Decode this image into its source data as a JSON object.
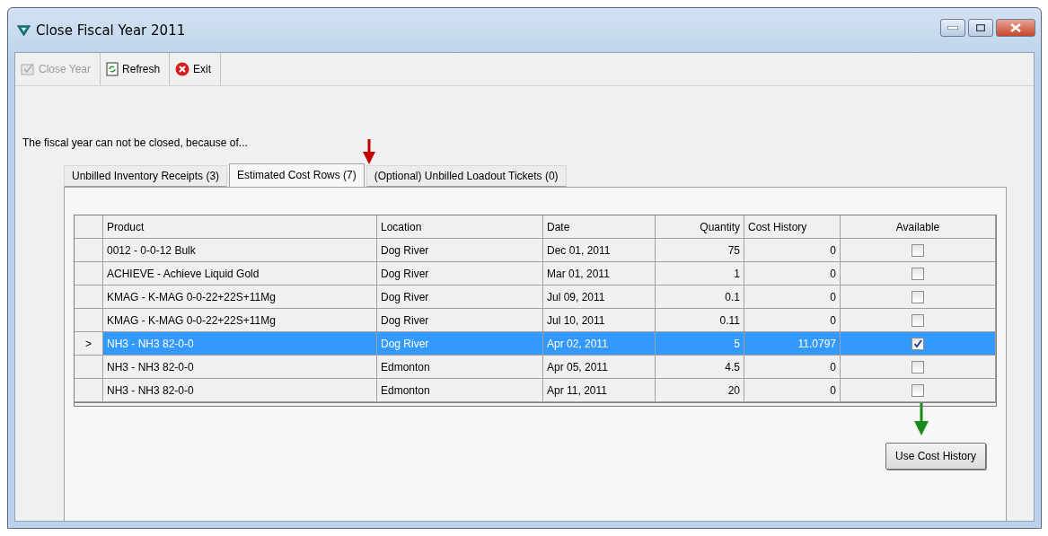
{
  "window": {
    "title": "Close Fiscal Year 2011"
  },
  "toolbar": [
    {
      "label": "Close Year",
      "kind": "close",
      "disabled": true
    },
    {
      "label": "Refresh",
      "kind": "refresh",
      "disabled": false
    },
    {
      "label": "Exit",
      "kind": "exit",
      "disabled": false
    }
  ],
  "message": "The fiscal year can not be closed, because of...",
  "tabs": [
    {
      "label": "Unbilled Inventory Receipts (3)",
      "selected": false
    },
    {
      "label": "Estimated Cost Rows (7)",
      "selected": true
    },
    {
      "label": "(Optional) Unbilled Loadout Tickets (0)",
      "selected": false
    }
  ],
  "table": {
    "columns": [
      "Product",
      "Location",
      "Date",
      "Quantity",
      "Cost History",
      "Available"
    ],
    "rows": [
      {
        "product": "0012 - 0-0-12 Bulk",
        "location": "Dog River",
        "date": "Dec 01, 2011",
        "quantity": "75",
        "cost_history": "0",
        "available": false,
        "selected": false
      },
      {
        "product": "ACHIEVE - Achieve Liquid Gold",
        "location": "Dog River",
        "date": "Mar 01, 2011",
        "quantity": "1",
        "cost_history": "0",
        "available": false,
        "selected": false
      },
      {
        "product": "KMAG - K-MAG 0-0-22+22S+11Mg",
        "location": "Dog River",
        "date": "Jul 09, 2011",
        "quantity": "0.1",
        "cost_history": "0",
        "available": false,
        "selected": false
      },
      {
        "product": "KMAG - K-MAG 0-0-22+22S+11Mg",
        "location": "Dog River",
        "date": "Jul 10, 2011",
        "quantity": "0.11",
        "cost_history": "0",
        "available": false,
        "selected": false
      },
      {
        "product": "NH3 - NH3 82-0-0",
        "location": "Dog River",
        "date": "Apr 02, 2011",
        "quantity": "5",
        "cost_history": "11.0797",
        "available": true,
        "selected": true,
        "marker": ">"
      },
      {
        "product": "NH3 - NH3 82-0-0",
        "location": "Edmonton",
        "date": "Apr 05, 2011",
        "quantity": "4.5",
        "cost_history": "0",
        "available": false,
        "selected": false
      },
      {
        "product": "NH3 - NH3 82-0-0",
        "location": "Edmonton",
        "date": "Apr 11, 2011",
        "quantity": "20",
        "cost_history": "0",
        "available": false,
        "selected": false
      }
    ]
  },
  "action_button": "Use Cost History"
}
